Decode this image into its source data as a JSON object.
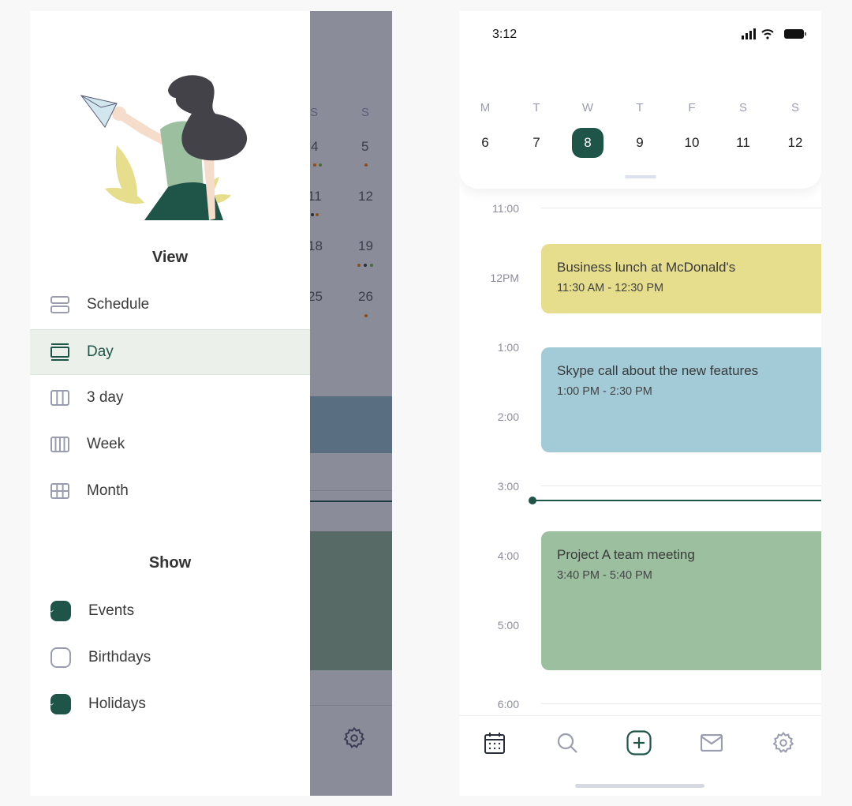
{
  "left_screen": {
    "background_calendar": {
      "weekday_headers": [
        "S",
        "S"
      ],
      "rows": [
        [
          "4",
          "5"
        ],
        [
          "11",
          "12"
        ],
        [
          "18",
          "19"
        ],
        [
          "25",
          "26"
        ]
      ]
    },
    "drawer": {
      "view_title": "View",
      "view_items": [
        {
          "label": "Schedule",
          "icon": "schedule-icon",
          "selected": false
        },
        {
          "label": "Day",
          "icon": "day-icon",
          "selected": true
        },
        {
          "label": "3 day",
          "icon": "three-day-icon",
          "selected": false
        },
        {
          "label": "Week",
          "icon": "week-icon",
          "selected": false
        },
        {
          "label": "Month",
          "icon": "month-icon",
          "selected": false
        }
      ],
      "show_title": "Show",
      "show_items": [
        {
          "label": "Events",
          "checked": true
        },
        {
          "label": "Birthdays",
          "checked": false
        },
        {
          "label": "Holidays",
          "checked": true
        }
      ]
    }
  },
  "right_screen": {
    "status_time": "3:12",
    "week": {
      "days": [
        "M",
        "T",
        "W",
        "T",
        "F",
        "S",
        "S"
      ],
      "dates": [
        "6",
        "7",
        "8",
        "9",
        "10",
        "11",
        "12"
      ],
      "selected": "8"
    },
    "hours": [
      "11:00",
      "12PM",
      "1:00",
      "2:00",
      "3:00",
      "4:00",
      "5:00",
      "6:00"
    ],
    "events": [
      {
        "title": "Business lunch at McDonald's",
        "time": "11:30 AM - 12:30 PM",
        "color": "#e6de8c"
      },
      {
        "title": "Skype call about the new features",
        "time": "1:00 PM - 2:30 PM",
        "color": "#a2cbd7"
      },
      {
        "title": "Project A team meeting",
        "time": "3:40 PM - 5:40 PM",
        "color": "#9cbfa0"
      }
    ],
    "tabs": [
      "calendar-icon",
      "search-icon",
      "add-icon",
      "mail-icon",
      "settings-icon"
    ]
  },
  "colors": {
    "accent": "#1f5449",
    "selected_bg": "#ebf1ea",
    "overlay": "#8a8c99"
  }
}
